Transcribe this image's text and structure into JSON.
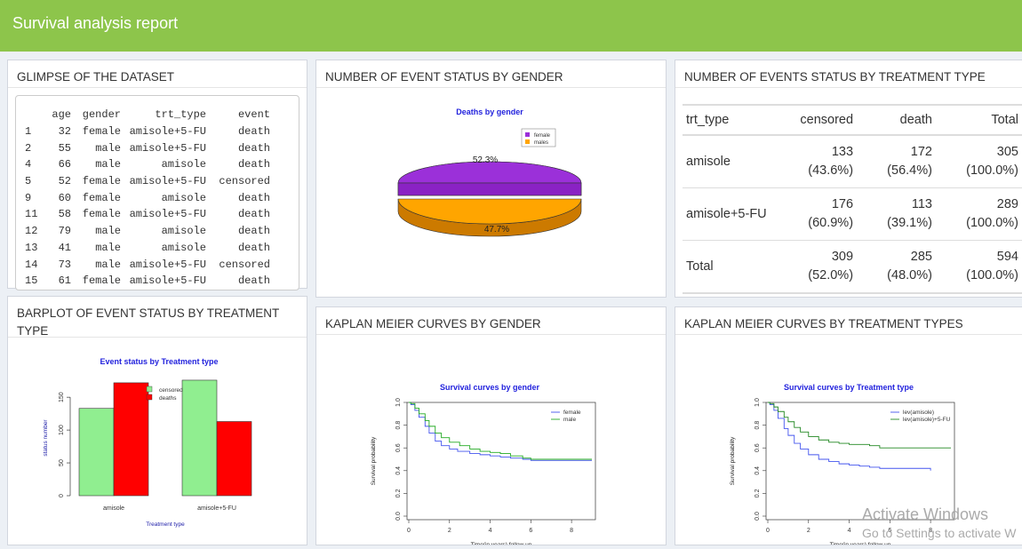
{
  "header": {
    "title": "Survival analysis report",
    "color": "#8dc54b"
  },
  "glimpse": {
    "title": "GLIMPSE OF THE DATASET",
    "columns": [
      "",
      "age",
      "gender",
      "trt_type",
      "event"
    ],
    "rows": [
      [
        "1",
        "32",
        "female",
        "amisole+5-FU",
        "death"
      ],
      [
        "2",
        "55",
        "male",
        "amisole+5-FU",
        "death"
      ],
      [
        "4",
        "66",
        "male",
        "amisole",
        "death"
      ],
      [
        "5",
        "52",
        "female",
        "amisole+5-FU",
        "censored"
      ],
      [
        "9",
        "60",
        "female",
        "amisole",
        "death"
      ],
      [
        "11",
        "58",
        "female",
        "amisole+5-FU",
        "death"
      ],
      [
        "12",
        "79",
        "male",
        "amisole",
        "death"
      ],
      [
        "13",
        "41",
        "male",
        "amisole",
        "death"
      ],
      [
        "14",
        "73",
        "male",
        "amisole+5-FU",
        "censored"
      ],
      [
        "15",
        "61",
        "female",
        "amisole+5-FU",
        "death"
      ]
    ]
  },
  "pie": {
    "box_title": "NUMBER OF EVENT STATUS BY GENDER",
    "chart_data": {
      "type": "pie",
      "title": "Deaths by gender",
      "slices": [
        {
          "label": "female",
          "percent": 52.3,
          "color": "#9b30d9"
        },
        {
          "label": "males",
          "percent": 47.7,
          "color": "#ffa500"
        }
      ],
      "value_labels": [
        "52.3%",
        "47.7%"
      ],
      "legend": [
        "female",
        "males"
      ],
      "legend_position": "top-right"
    }
  },
  "event_table": {
    "title": "NUMBER OF EVENTS STATUS BY TREATMENT TYPE",
    "headers": [
      "trt_type",
      "censored",
      "death",
      "Total"
    ],
    "rows": [
      {
        "label": "amisole",
        "censored": "133",
        "censored_pct": "(43.6%)",
        "death": "172",
        "death_pct": "(56.4%)",
        "total": "305",
        "total_pct": "(100.0%)"
      },
      {
        "label": "amisole+5-FU",
        "censored": "176",
        "censored_pct": "(60.9%)",
        "death": "113",
        "death_pct": "(39.1%)",
        "total": "289",
        "total_pct": "(100.0%)"
      },
      {
        "label": "Total",
        "censored": "309",
        "censored_pct": "(52.0%)",
        "death": "285",
        "death_pct": "(48.0%)",
        "total": "594",
        "total_pct": "(100.0%)"
      }
    ]
  },
  "barplot": {
    "box_title": "BARPLOT OF EVENT STATUS BY TREATMENT TYPE",
    "chart_data": {
      "type": "bar",
      "title": "Event status by Treatment type",
      "categories": [
        "amisole",
        "amisole+5-FU"
      ],
      "series": [
        {
          "name": "censored",
          "values": [
            133,
            176
          ],
          "color": "#90ee90"
        },
        {
          "name": "deaths",
          "values": [
            172,
            113
          ],
          "color": "#ff0000"
        }
      ],
      "xlabel": "Treatment type",
      "ylabel": "status number",
      "yticks": [
        "0",
        "50",
        "100",
        "150"
      ],
      "ylim": [
        0,
        180
      ],
      "legend_position": "top-right"
    }
  },
  "km_gender": {
    "box_title": "KAPLAN MEIER CURVES BY GENDER",
    "chart_data": {
      "type": "line",
      "title": "Survival curves by gender",
      "xlabel": "Time(in years) follow up",
      "ylabel": "Survival probability",
      "xticks": [
        "0",
        "2",
        "4",
        "6",
        "8"
      ],
      "yticks": [
        "0.0",
        "0.2",
        "0.4",
        "0.6",
        "0.8",
        "1.0"
      ],
      "xlim": [
        0,
        9
      ],
      "ylim": [
        0,
        1
      ],
      "series": [
        {
          "name": "female",
          "color": "#4455ee",
          "x": [
            0,
            0.1,
            0.3,
            0.5,
            0.8,
            1.0,
            1.3,
            1.6,
            2.0,
            2.4,
            3.0,
            3.5,
            4.0,
            4.5,
            5.0,
            5.6,
            6.0,
            7.0,
            8.0,
            9.0
          ],
          "y": [
            1.0,
            0.98,
            0.93,
            0.87,
            0.79,
            0.73,
            0.66,
            0.62,
            0.59,
            0.57,
            0.55,
            0.54,
            0.53,
            0.52,
            0.51,
            0.5,
            0.49,
            0.49,
            0.49,
            0.49
          ]
        },
        {
          "name": "male",
          "color": "#22aa22",
          "x": [
            0,
            0.1,
            0.3,
            0.5,
            0.8,
            1.0,
            1.3,
            1.6,
            2.0,
            2.5,
            3.0,
            3.5,
            4.0,
            4.5,
            5.0,
            5.6,
            6.0,
            7.0,
            8.0,
            9.0
          ],
          "y": [
            1.0,
            0.99,
            0.95,
            0.9,
            0.84,
            0.79,
            0.73,
            0.69,
            0.65,
            0.62,
            0.59,
            0.57,
            0.56,
            0.55,
            0.53,
            0.51,
            0.5,
            0.5,
            0.5,
            0.5
          ]
        }
      ],
      "legend_position": "top-right"
    }
  },
  "km_treatment": {
    "box_title": "KAPLAN MEIER CURVES BY TREATMENT TYPES",
    "chart_data": {
      "type": "line",
      "title": "Survival curves by Treatment type",
      "xlabel": "Time(in years) follow up",
      "ylabel": "Survival probability",
      "xticks": [
        "0",
        "2",
        "4",
        "6",
        "8"
      ],
      "yticks": [
        "0.0",
        "0.2",
        "0.4",
        "0.6",
        "0.8",
        "1.0"
      ],
      "xlim": [
        0,
        9
      ],
      "ylim": [
        0,
        1
      ],
      "series": [
        {
          "name": "lev(amisole)",
          "color": "#4455ee",
          "x": [
            0,
            0.1,
            0.3,
            0.5,
            0.8,
            1.0,
            1.3,
            1.6,
            2.0,
            2.5,
            3.0,
            3.5,
            4.0,
            4.5,
            5.0,
            5.5,
            6.0,
            7.0,
            8.0
          ],
          "y": [
            1.0,
            0.98,
            0.93,
            0.86,
            0.77,
            0.71,
            0.64,
            0.59,
            0.54,
            0.5,
            0.48,
            0.46,
            0.45,
            0.44,
            0.43,
            0.42,
            0.42,
            0.42,
            0.4
          ]
        },
        {
          "name": "lev(amisole)+5-FU",
          "color": "#228822",
          "x": [
            0,
            0.1,
            0.3,
            0.5,
            0.8,
            1.0,
            1.3,
            1.6,
            2.0,
            2.5,
            3.0,
            3.5,
            4.0,
            5.0,
            5.5,
            6.0,
            7.0,
            8.0,
            9.0
          ],
          "y": [
            1.0,
            0.99,
            0.96,
            0.92,
            0.87,
            0.83,
            0.78,
            0.74,
            0.7,
            0.67,
            0.65,
            0.64,
            0.63,
            0.62,
            0.6,
            0.6,
            0.6,
            0.6,
            0.6
          ]
        }
      ],
      "legend_position": "top-right"
    }
  },
  "watermark": {
    "line1": "Activate Windows",
    "line2": "Go to Settings to activate W"
  }
}
